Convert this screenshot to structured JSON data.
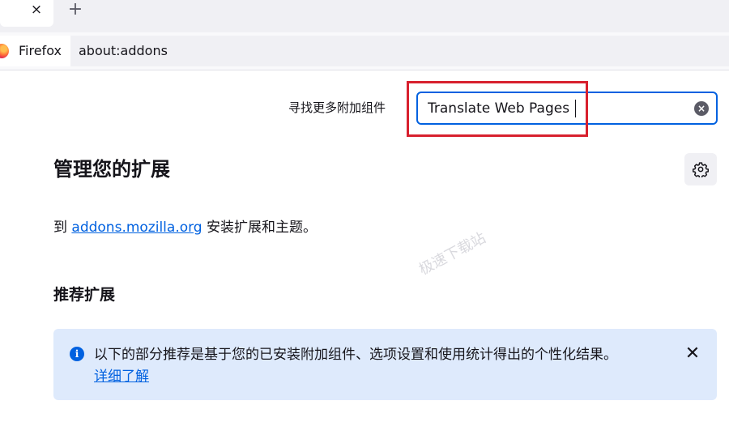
{
  "tabs": {
    "close_glyph": "×",
    "new_tab_glyph": "+"
  },
  "navbar": {
    "identity_label": "Firefox",
    "url": "about:addons"
  },
  "search": {
    "label": "寻找更多附加组件",
    "value": "Translate Web Pages",
    "clear_glyph": "×"
  },
  "main": {
    "title": "管理您的扩展",
    "intro_prefix": "到 ",
    "intro_link": "addons.mozilla.org",
    "intro_suffix": " 安装扩展和主题。",
    "section_title": "推荐扩展",
    "watermark": "极速下载站"
  },
  "notice": {
    "info_glyph": "i",
    "text": "以下的部分推荐是基于您的已安装附加组件、选项设置和使用统计得出的个性化结果。",
    "link": "详细了解",
    "close_glyph": "✕"
  },
  "colors": {
    "accent": "#0061e0",
    "highlight": "#d8202e",
    "notice_bg": "#deeafc"
  },
  "icons": [
    "close-icon",
    "plus-icon",
    "firefox-logo-icon",
    "clear-icon",
    "gear-icon",
    "info-icon",
    "close-icon"
  ]
}
